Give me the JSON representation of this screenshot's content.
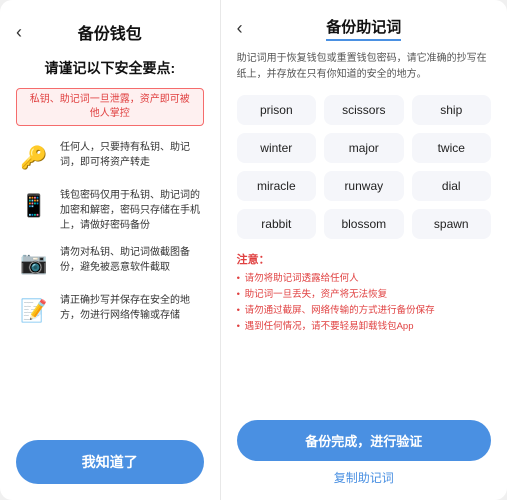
{
  "left": {
    "back_icon": "‹",
    "title": "备份钱包",
    "subtitle": "请谨记以下安全要点:",
    "warning": "私钥、助记词一旦泄露，资产即可被他人掌控",
    "security_items": [
      {
        "icon": "🔑",
        "text": "任何人，只要持有私钥、助记词，即可将资产转走"
      },
      {
        "icon": "📱",
        "text": "钱包密码仅用于私钥、助记词的加密和解密，密码只存储在手机上，请做好密码备份"
      },
      {
        "icon": "📷",
        "text": "请勿对私钥、助记词做截图备份，避免被恶意软件截取"
      },
      {
        "icon": "📝",
        "text": "请正确抄写并保存在安全的地方，勿进行网络传输或存储"
      }
    ],
    "button_label": "我知道了"
  },
  "right": {
    "back_icon": "‹",
    "title": "备份助记词",
    "description": "助记词用于恢复钱包或重置钱包密码，请它准确的抄写在纸上，并存放在只有你知道的安全的地方。",
    "mnemonic_words": [
      "prison",
      "scissors",
      "ship",
      "winter",
      "major",
      "twice",
      "miracle",
      "runway",
      "dial",
      "rabbit",
      "blossom",
      "spawn"
    ],
    "notes_title": "注意：",
    "notes": [
      "请勿将助记词透露给任何人",
      "助记词一旦丢失，资产将无法恢复",
      "请勿通过截屏、网络传输的方式进行备份保存",
      "遇到任何情况，请不要轻易卸载钱包App"
    ],
    "confirm_button": "备份完成，进行验证",
    "copy_button": "复制助记词"
  }
}
